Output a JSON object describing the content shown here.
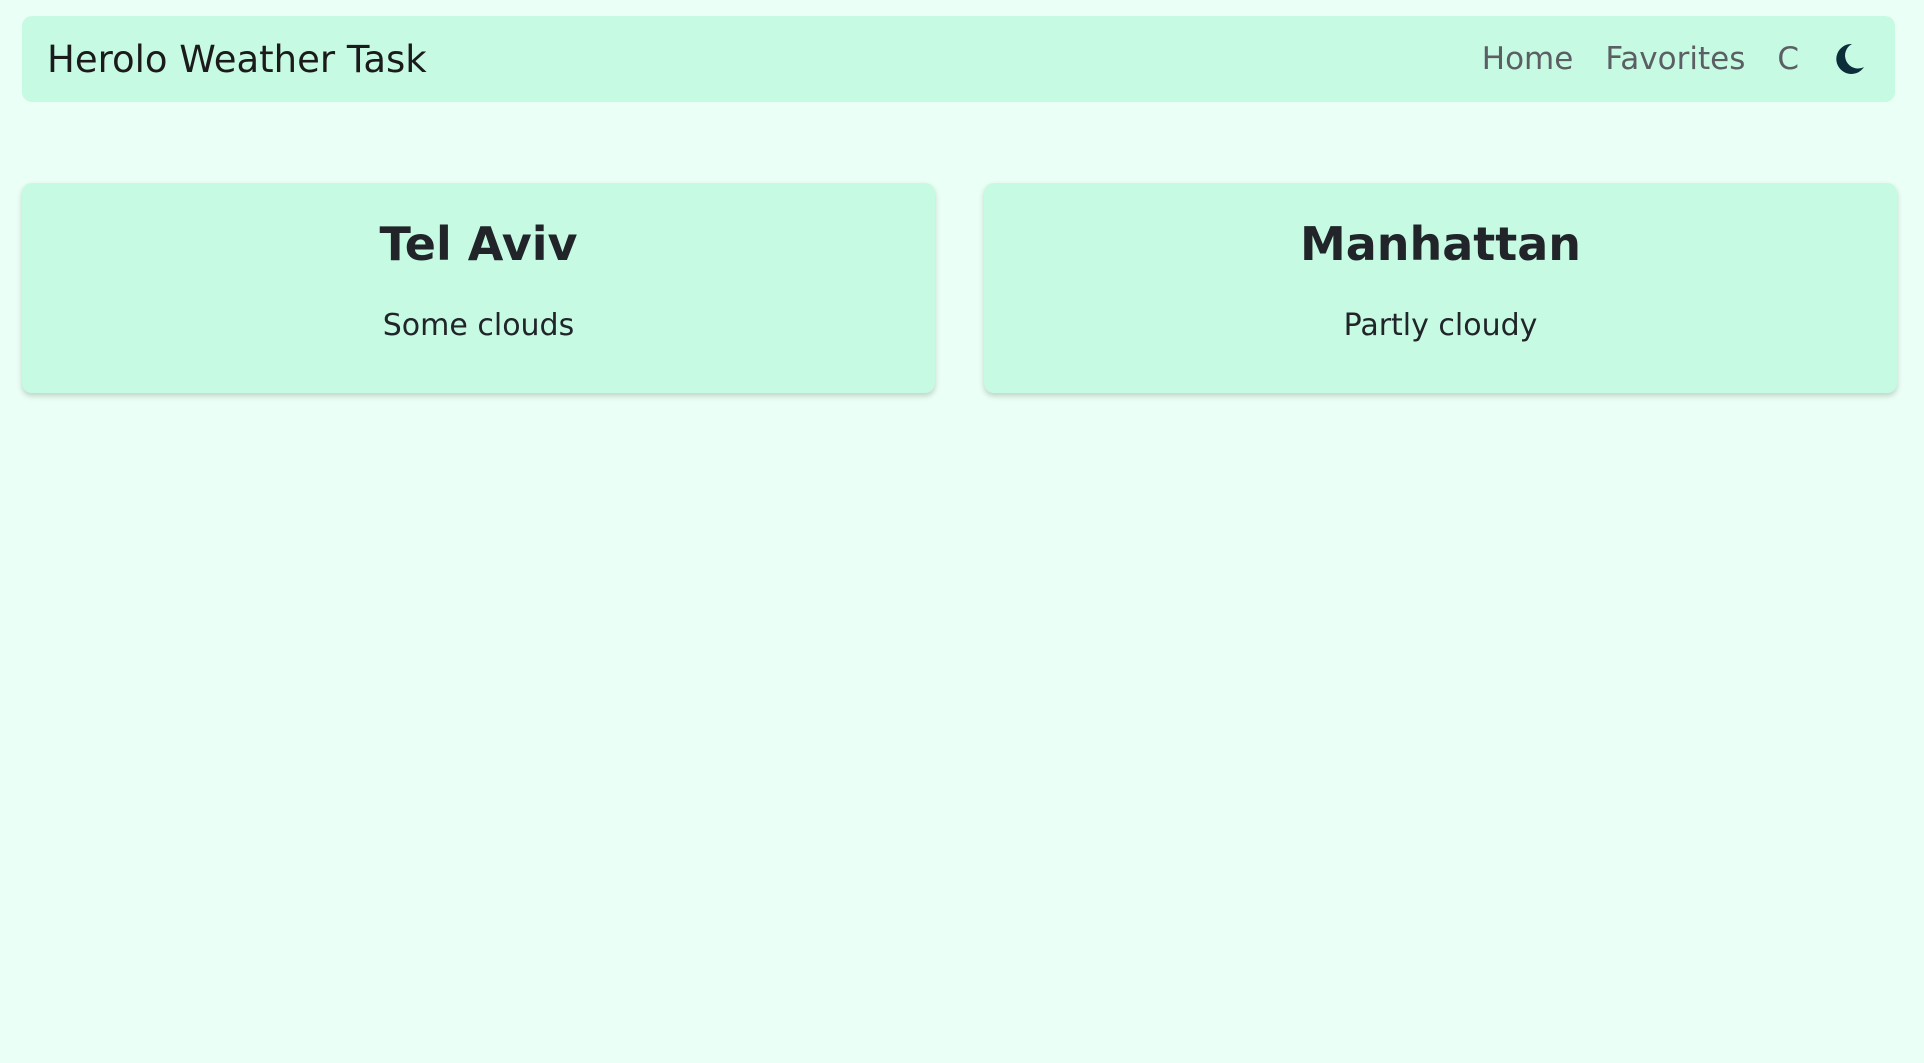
{
  "navbar": {
    "brand": "Herolo Weather Task",
    "links": {
      "home": "Home",
      "favorites": "Favorites",
      "unit": "C"
    },
    "theme_icon": "moon-icon"
  },
  "favorites": [
    {
      "city": "Tel Aviv",
      "weather": "Some clouds"
    },
    {
      "city": "Manhattan",
      "weather": "Partly cloudy"
    }
  ],
  "colors": {
    "background": "#eafff6",
    "surface": "#c6fae3",
    "icon": "#0b2e3a"
  }
}
